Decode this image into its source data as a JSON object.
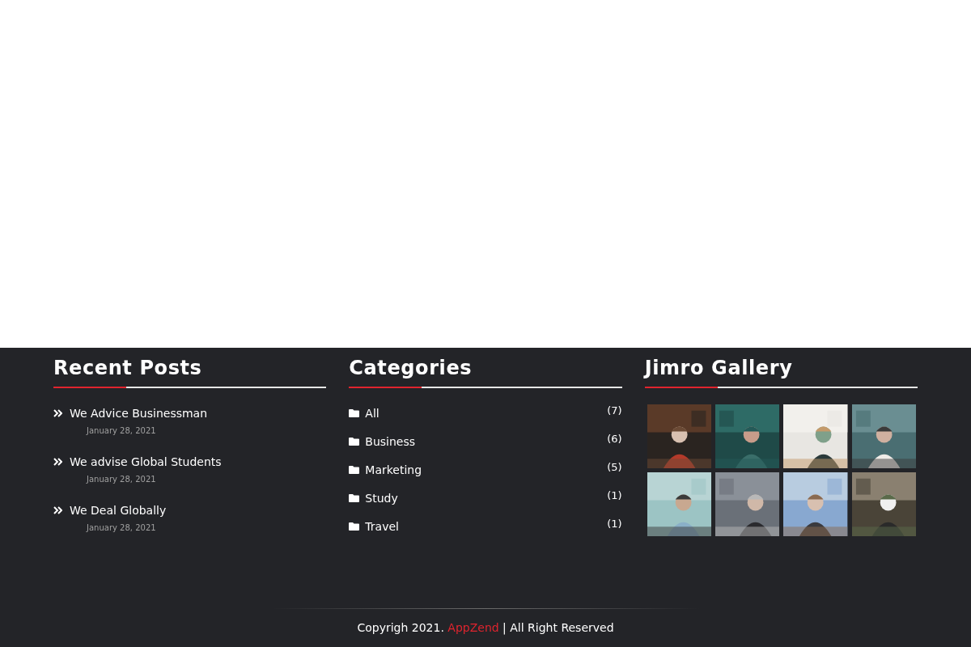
{
  "recent_posts": {
    "title": "Recent Posts",
    "posts": [
      {
        "title": "We Advice Businessman",
        "date": "January 28, 2021"
      },
      {
        "title": "We advise Global Students",
        "date": "January 28, 2021"
      },
      {
        "title": "We Deal Globally",
        "date": "January 28, 2021"
      }
    ]
  },
  "categories": {
    "title": "Categories",
    "items": [
      {
        "label": "All",
        "count": "(7)"
      },
      {
        "label": "Business",
        "count": "(6)"
      },
      {
        "label": "Marketing",
        "count": "(5)"
      },
      {
        "label": "Study",
        "count": "(1)"
      },
      {
        "label": "Travel",
        "count": "(1)"
      }
    ]
  },
  "gallery": {
    "title": "Jimro Gallery"
  },
  "copyright": {
    "prefix": "Copyrigh 2021.",
    "brand": "AppZend",
    "suffix": "| All Right Reserved"
  }
}
